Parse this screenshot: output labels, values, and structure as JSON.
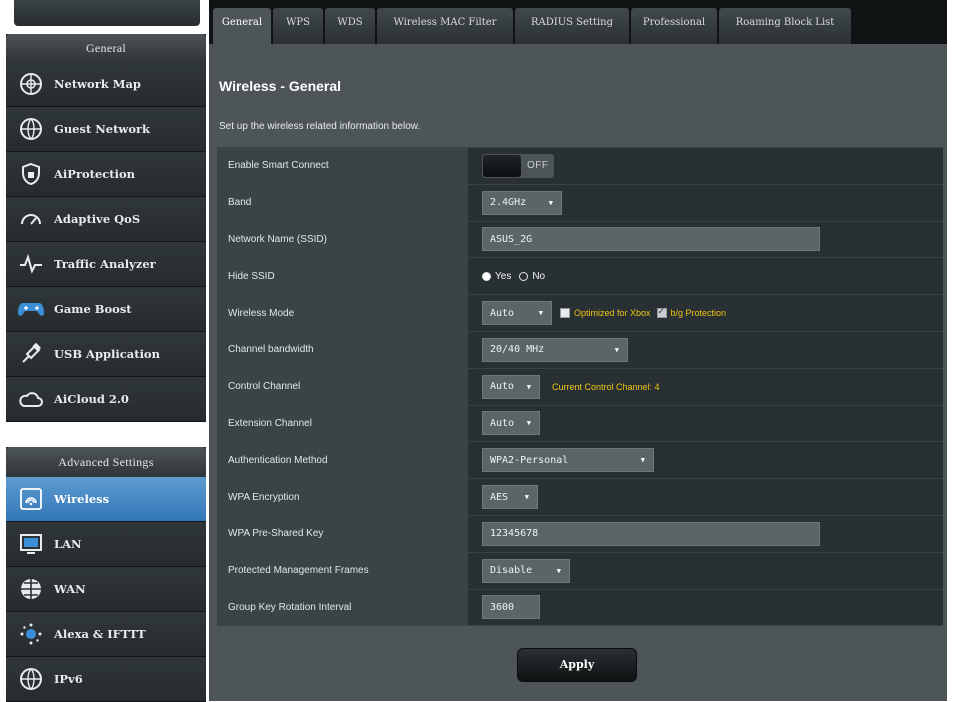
{
  "sidebar": {
    "general_header": "General",
    "general_items": [
      {
        "label": "Network Map",
        "icon": "network-map-icon"
      },
      {
        "label": "Guest Network",
        "icon": "guest-network-icon"
      },
      {
        "label": "AiProtection",
        "icon": "shield-icon"
      },
      {
        "label": "Adaptive QoS",
        "icon": "gauge-icon"
      },
      {
        "label": "Traffic Analyzer",
        "icon": "traffic-analyzer-icon"
      },
      {
        "label": "Game Boost",
        "icon": "gamepad-icon"
      },
      {
        "label": "USB Application",
        "icon": "usb-icon"
      },
      {
        "label": "AiCloud 2.0",
        "icon": "cloud-icon"
      }
    ],
    "advanced_header": "Advanced Settings",
    "advanced_items": [
      {
        "label": "Wireless",
        "icon": "wifi-icon",
        "active": true
      },
      {
        "label": "LAN",
        "icon": "monitor-icon"
      },
      {
        "label": "WAN",
        "icon": "globe-icon"
      },
      {
        "label": "Alexa & IFTTT",
        "icon": "alexa-icon"
      },
      {
        "label": "IPv6",
        "icon": "ipv6-icon"
      }
    ]
  },
  "tabs": [
    {
      "label": "General",
      "active": true
    },
    {
      "label": "WPS"
    },
    {
      "label": "WDS"
    },
    {
      "label": "Wireless MAC Filter"
    },
    {
      "label": "RADIUS Setting"
    },
    {
      "label": "Professional"
    },
    {
      "label": "Roaming Block List"
    }
  ],
  "page": {
    "title": "Wireless - General",
    "subtitle": "Set up the wireless related information below."
  },
  "settings": {
    "smart_connect": {
      "label": "Enable Smart Connect",
      "state": "OFF"
    },
    "band": {
      "label": "Band",
      "value": "2.4GHz"
    },
    "ssid": {
      "label": "Network Name (SSID)",
      "value": "ASUS_2G"
    },
    "hide_ssid": {
      "label": "Hide SSID",
      "yes": "Yes",
      "no": "No",
      "selected": "Yes"
    },
    "wireless_mode": {
      "label": "Wireless Mode",
      "value": "Auto",
      "opt_xbox": "Optimized for Xbox",
      "opt_bg": "b/g Protection",
      "bg_checked": true
    },
    "channel_bandwidth": {
      "label": "Channel bandwidth",
      "value": "20/40 MHz"
    },
    "control_channel": {
      "label": "Control Channel",
      "value": "Auto",
      "note": "Current Control Channel: 4"
    },
    "extension_channel": {
      "label": "Extension Channel",
      "value": "Auto"
    },
    "auth_method": {
      "label": "Authentication Method",
      "value": "WPA2-Personal"
    },
    "wpa_encryption": {
      "label": "WPA Encryption",
      "value": "AES"
    },
    "psk": {
      "label": "WPA Pre-Shared Key",
      "value": "12345678"
    },
    "pmf": {
      "label": "Protected Management Frames",
      "value": "Disable"
    },
    "group_key": {
      "label": "Group Key Rotation Interval",
      "value": "3600"
    }
  },
  "actions": {
    "apply": "Apply"
  },
  "colors": {
    "accent": "#3a7fc0",
    "note": "#f0c515",
    "panel": "#4d5558"
  }
}
